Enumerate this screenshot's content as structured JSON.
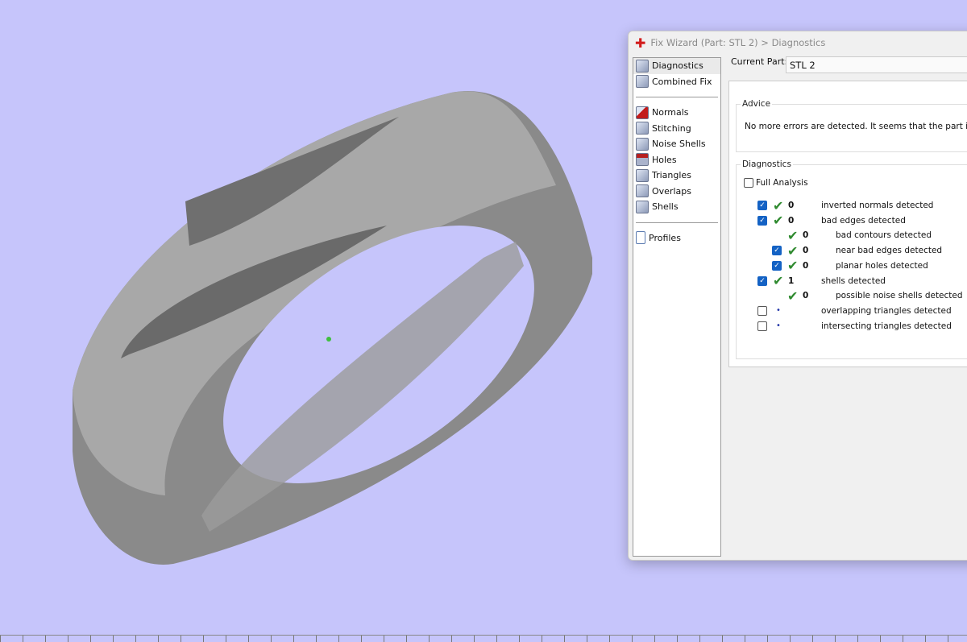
{
  "window": {
    "title": "Fix Wizard (Part: STL 2) > Diagnostics"
  },
  "nav": {
    "top": [
      {
        "label": "Diagnostics",
        "icon": "magnifier-icon"
      },
      {
        "label": "Combined Fix",
        "icon": "cube-icon"
      }
    ],
    "tools": [
      {
        "label": "Normals",
        "icon": "normals-icon"
      },
      {
        "label": "Stitching",
        "icon": "stitching-icon"
      },
      {
        "label": "Noise Shells",
        "icon": "noise-shells-icon"
      },
      {
        "label": "Holes",
        "icon": "holes-icon"
      },
      {
        "label": "Triangles",
        "icon": "triangles-icon"
      },
      {
        "label": "Overlaps",
        "icon": "overlaps-icon"
      },
      {
        "label": "Shells",
        "icon": "shells-icon"
      }
    ],
    "bottom": [
      {
        "label": "Profiles",
        "icon": "document-icon"
      }
    ]
  },
  "current_part": {
    "label": "Current Part:",
    "value": "STL 2"
  },
  "advice": {
    "legend": "Advice",
    "text": "No more errors are detected. It seems that the part is ok. Not"
  },
  "diagnostics": {
    "legend": "Diagnostics",
    "full_analysis": {
      "label": "Full Analysis",
      "checked": false
    },
    "rows": [
      {
        "checkbox": true,
        "checked": true,
        "status": "ok",
        "count": "0",
        "label": "inverted normals detected",
        "indent": 0
      },
      {
        "checkbox": true,
        "checked": true,
        "status": "ok",
        "count": "0",
        "label": "bad edges detected",
        "indent": 0
      },
      {
        "checkbox": false,
        "checked": false,
        "status": "ok",
        "count": "0",
        "label": "bad contours detected",
        "indent": 1
      },
      {
        "checkbox": true,
        "checked": true,
        "status": "ok",
        "count": "0",
        "label": "near bad edges detected",
        "indent": 1
      },
      {
        "checkbox": true,
        "checked": true,
        "status": "ok",
        "count": "0",
        "label": "planar holes detected",
        "indent": 1
      },
      {
        "checkbox": true,
        "checked": true,
        "status": "ok",
        "count": "1",
        "label": "shells detected",
        "indent": 0
      },
      {
        "checkbox": false,
        "checked": false,
        "status": "ok",
        "count": "0",
        "label": "possible noise shells detected",
        "indent": 1
      },
      {
        "checkbox": true,
        "checked": false,
        "status": "pending",
        "count": "",
        "label": "overlapping triangles detected",
        "indent": 0
      },
      {
        "checkbox": true,
        "checked": false,
        "status": "pending",
        "count": "",
        "label": "intersecting triangles detected",
        "indent": 0
      }
    ]
  }
}
